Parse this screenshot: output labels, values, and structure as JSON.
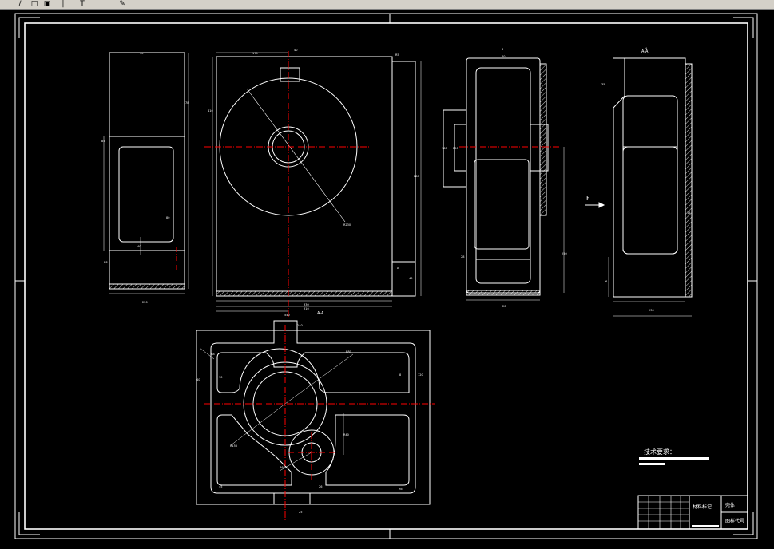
{
  "toolbar": {
    "buttons": [
      {
        "name": "pan-tool-icon",
        "glyph": "/"
      },
      {
        "name": "new-document-icon",
        "glyph": "□"
      },
      {
        "name": "save-icon",
        "glyph": "▣"
      },
      {
        "name": "separator-icon",
        "glyph": "│"
      },
      {
        "name": "text-tool-icon",
        "glyph": "T"
      },
      {
        "name": "paint-tool-icon",
        "glyph": "✎"
      }
    ]
  },
  "drawing": {
    "dims_left_view": [
      "40",
      "78",
      "85",
      "80",
      "40",
      "R8",
      "220"
    ],
    "dims_front_view": [
      "175",
      "R5",
      "410",
      "R230",
      "40",
      "280",
      "310",
      "330",
      "40",
      "540",
      "A"
    ],
    "dims_side_view": [
      "8",
      "40",
      "160",
      "250",
      "250",
      "28",
      "20"
    ],
    "dims_right_view": [
      "A",
      "35",
      "15",
      "6",
      "230"
    ],
    "dims_plan_view": [
      "140",
      "R8",
      "R155",
      "R80",
      "R60",
      "R40",
      "120",
      "R6",
      "45",
      "25",
      "26",
      "10",
      "8",
      "40"
    ],
    "force_label": "F",
    "section_label": "A-A",
    "tech_req_title": "技术要求：",
    "title_block": {
      "material_mark": "材料标记",
      "part_name": "壳体",
      "drawing_no": "图样代号"
    }
  },
  "colors": {
    "line": "#ffffff",
    "center_line": "#ff0000",
    "background": "#000000"
  }
}
